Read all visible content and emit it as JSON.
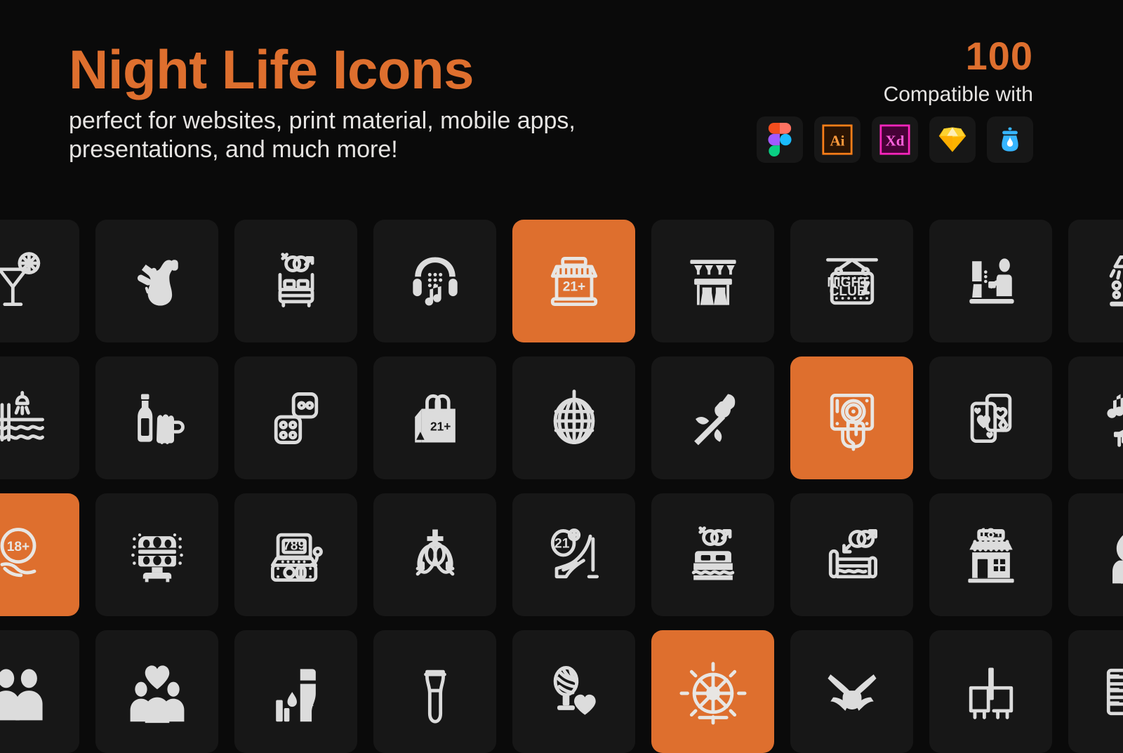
{
  "hero": {
    "title": "Night Life Icons",
    "subtitle": "perfect for websites, print material, mobile apps, presentations, and much more!"
  },
  "compatibility": {
    "count": "100",
    "label": "Compatible with",
    "apps": [
      {
        "name": "figma-icon",
        "label": "Figma"
      },
      {
        "name": "adobe-illustrator-icon",
        "label": "Ai"
      },
      {
        "name": "adobe-xd-icon",
        "label": "Xd"
      },
      {
        "name": "sketch-icon",
        "label": "Sketch"
      },
      {
        "name": "lunacy-icon",
        "label": "Lunacy"
      }
    ]
  },
  "colors": {
    "background": "#0a0a0a",
    "tile": "#171717",
    "accent": "#de6f2e",
    "icon": "#dcdcdc",
    "text": "#e6e4e2"
  },
  "grid": {
    "columns": 9,
    "rows": 4,
    "icons": [
      {
        "name": "cocktail-icon",
        "label": "Cocktail",
        "accent": false,
        "badge": ""
      },
      {
        "name": "saxophone-icon",
        "label": "Saxophone",
        "accent": false,
        "badge": ""
      },
      {
        "name": "bed-gender-icon",
        "label": "Bed Gender Symbols",
        "accent": false,
        "badge": ""
      },
      {
        "name": "headphones-music-icon",
        "label": "Headphones Music",
        "accent": false,
        "badge": ""
      },
      {
        "name": "shop-21plus-icon",
        "label": "Adult Shop",
        "accent": true,
        "badge": "21+"
      },
      {
        "name": "bar-counter-icon",
        "label": "Bar Counter",
        "accent": false,
        "badge": ""
      },
      {
        "name": "night-club-sign-icon",
        "label": "Night Club Sign",
        "accent": false,
        "badge": "NIGHT CLUB"
      },
      {
        "name": "bartender-icon",
        "label": "Bartender",
        "accent": false,
        "badge": ""
      },
      {
        "name": "lamp-table-icon",
        "label": "Lamp Table",
        "accent": false,
        "badge": ""
      },
      {
        "name": "pool-shower-icon",
        "label": "Pool Shower",
        "accent": false,
        "badge": ""
      },
      {
        "name": "beer-bottle-mug-icon",
        "label": "Beer Bottle Mug",
        "accent": false,
        "badge": ""
      },
      {
        "name": "dice-icon",
        "label": "Dice",
        "accent": false,
        "badge": ""
      },
      {
        "name": "shopping-bag-21plus-icon",
        "label": "Adult Shopping Bag",
        "accent": false,
        "badge": "21+"
      },
      {
        "name": "disco-ball-icon",
        "label": "Disco Ball",
        "accent": false,
        "badge": ""
      },
      {
        "name": "rose-icon",
        "label": "Rose",
        "accent": false,
        "badge": ""
      },
      {
        "name": "dj-turntable-icon",
        "label": "DJ Turntable",
        "accent": true,
        "badge": ""
      },
      {
        "name": "playing-cards-icon",
        "label": "Playing Cards",
        "accent": false,
        "badge": ""
      },
      {
        "name": "pianist-icon",
        "label": "Pianist",
        "accent": false,
        "badge": ""
      },
      {
        "name": "badge-18plus-icon",
        "label": "18 Plus Badge",
        "accent": true,
        "badge": "18+"
      },
      {
        "name": "stage-light-icon",
        "label": "Stage Light",
        "accent": false,
        "badge": ""
      },
      {
        "name": "slot-machine-icon",
        "label": "Slot Machine",
        "accent": false,
        "badge": "789"
      },
      {
        "name": "gender-symbols-icon",
        "label": "Gender Symbols",
        "accent": false,
        "badge": ""
      },
      {
        "name": "high-heel-21-icon",
        "label": "High Heel 21",
        "accent": false,
        "badge": "21"
      },
      {
        "name": "bed-couple-icon",
        "label": "Bed Couple",
        "accent": false,
        "badge": ""
      },
      {
        "name": "bed-side-icon",
        "label": "Bed Side View",
        "accent": false,
        "badge": ""
      },
      {
        "name": "store-18plus-icon",
        "label": "Adult Store",
        "accent": false,
        "badge": "18+"
      },
      {
        "name": "flame-hand-icon",
        "label": "Flame Hand",
        "accent": false,
        "badge": ""
      },
      {
        "name": "people-heart-icon",
        "label": "People Heart",
        "accent": false,
        "badge": ""
      },
      {
        "name": "group-love-icon",
        "label": "Group Love",
        "accent": false,
        "badge": ""
      },
      {
        "name": "candle-drink-icon",
        "label": "Candle Drink",
        "accent": false,
        "badge": ""
      },
      {
        "name": "condom-icon",
        "label": "Condom",
        "accent": false,
        "badge": ""
      },
      {
        "name": "microphone-heart-icon",
        "label": "Microphone Heart",
        "accent": false,
        "badge": ""
      },
      {
        "name": "ferris-wheel-icon",
        "label": "Ferris Wheel",
        "accent": true,
        "badge": ""
      },
      {
        "name": "bowtie-icon",
        "label": "Bow Tie",
        "accent": false,
        "badge": ""
      },
      {
        "name": "bar-stool-icon",
        "label": "Bar Stool",
        "accent": false,
        "badge": ""
      },
      {
        "name": "keyboard-piano-icon",
        "label": "Piano Keyboard",
        "accent": false,
        "badge": ""
      }
    ]
  }
}
